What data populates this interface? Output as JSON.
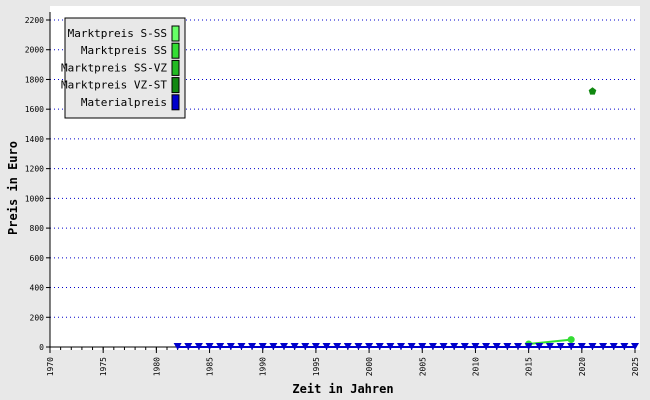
{
  "chart_data": {
    "type": "line",
    "xlabel": "Zeit in Jahren",
    "ylabel": "Preis in Euro",
    "xlim": [
      1970,
      2025
    ],
    "ylim": [
      0,
      2200
    ],
    "x_ticks": [
      1970,
      1975,
      1980,
      1985,
      1990,
      1995,
      2000,
      2005,
      2010,
      2015,
      2020,
      2025
    ],
    "y_ticks": [
      0,
      200,
      400,
      600,
      800,
      1000,
      1200,
      1400,
      1600,
      1800,
      2000,
      2200
    ],
    "grid": "horizontal dotted",
    "legend_position": "top-left",
    "series": [
      {
        "name": "Marktpreis S-SS",
        "color": "#66ff66",
        "marker": "none",
        "x": [],
        "y": []
      },
      {
        "name": "Marktpreis SS",
        "color": "#33dd33",
        "marker": "circle",
        "x": [
          2015,
          2019
        ],
        "y": [
          20,
          50
        ]
      },
      {
        "name": "Marktpreis SS-VZ",
        "color": "#22bb22",
        "marker": "none",
        "x": [],
        "y": []
      },
      {
        "name": "Marktpreis VZ-ST",
        "color": "#118811",
        "marker": "pentagon",
        "x": [
          2021
        ],
        "y": [
          1720
        ]
      },
      {
        "name": "Materialpreis",
        "color": "#0000cc",
        "marker": "triangle-down",
        "x": [
          1982,
          1983,
          1984,
          1985,
          1986,
          1987,
          1988,
          1989,
          1990,
          1991,
          1992,
          1993,
          1994,
          1995,
          1996,
          1997,
          1998,
          1999,
          2000,
          2001,
          2002,
          2003,
          2004,
          2005,
          2006,
          2007,
          2008,
          2009,
          2010,
          2011,
          2012,
          2013,
          2014,
          2015,
          2016,
          2017,
          2018,
          2019,
          2020,
          2021,
          2022,
          2023,
          2024,
          2025
        ],
        "y": [
          0,
          0,
          0,
          0,
          0,
          0,
          0,
          0,
          0,
          0,
          0,
          0,
          0,
          0,
          0,
          0,
          0,
          0,
          0,
          0,
          0,
          0,
          0,
          0,
          0,
          0,
          0,
          0,
          0,
          0,
          0,
          0,
          0,
          0,
          0,
          0,
          0,
          0,
          0,
          0,
          0,
          0,
          0,
          0
        ]
      }
    ]
  }
}
